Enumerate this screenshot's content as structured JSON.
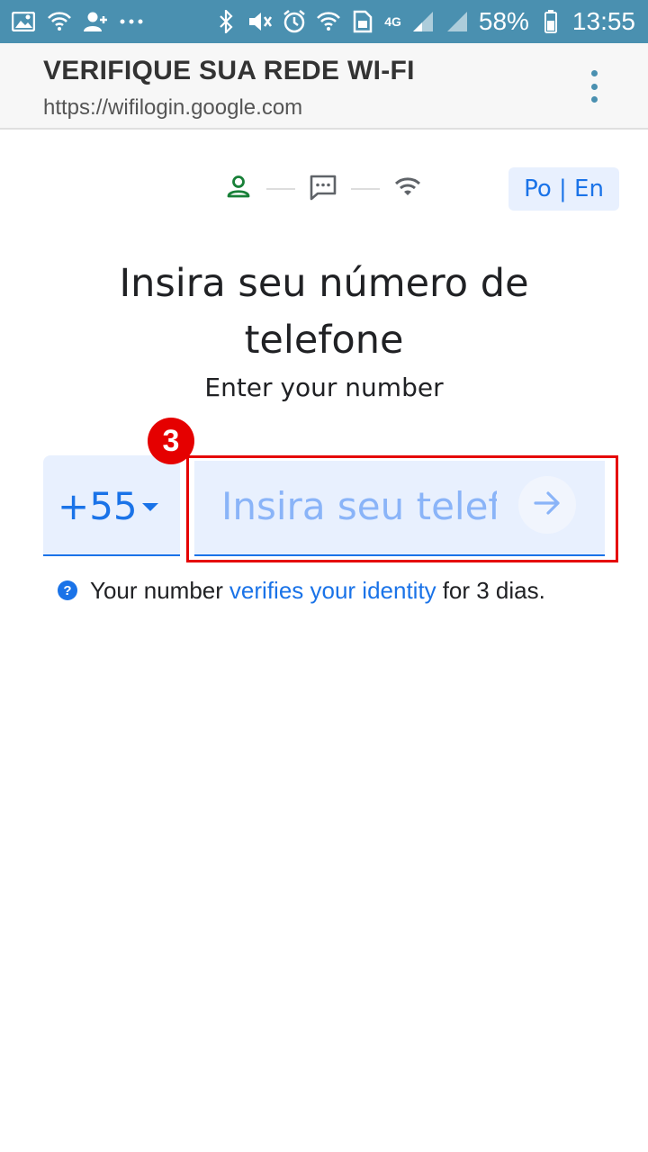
{
  "status_bar": {
    "battery": "58%",
    "time": "13:55",
    "network": "4G",
    "icons": [
      "image-icon",
      "wifi-question-icon",
      "add-contact-icon",
      "more-icon",
      "bluetooth-icon",
      "mute-icon",
      "alarm-icon",
      "wifi-icon",
      "sim-icon",
      "signal-icon",
      "battery-icon"
    ]
  },
  "app_bar": {
    "title": "VERIFIQUE SUA REDE WI-FI",
    "url": "https://wifilogin.google.com",
    "menu_icon": "more-vert-icon"
  },
  "stepper": {
    "steps": [
      "person-icon",
      "sms-icon",
      "wifi-icon"
    ],
    "active_color": "#188038",
    "inactive_color": "#5f6368"
  },
  "language": {
    "label": "Po | En"
  },
  "heading": "Insira seu número de telefone",
  "subheading": "Enter your number",
  "badge": "3",
  "country": {
    "code": "+55"
  },
  "phone": {
    "placeholder": "Insira seu telefone",
    "value": ""
  },
  "help": {
    "prefix": "Your number",
    "link": "verifies your identity",
    "suffix": "for 3 dias."
  },
  "colors": {
    "status_bar": "#4a90b0",
    "accent": "#1a73e8",
    "field_bg": "#e8f0fe",
    "highlight": "#e50000"
  }
}
